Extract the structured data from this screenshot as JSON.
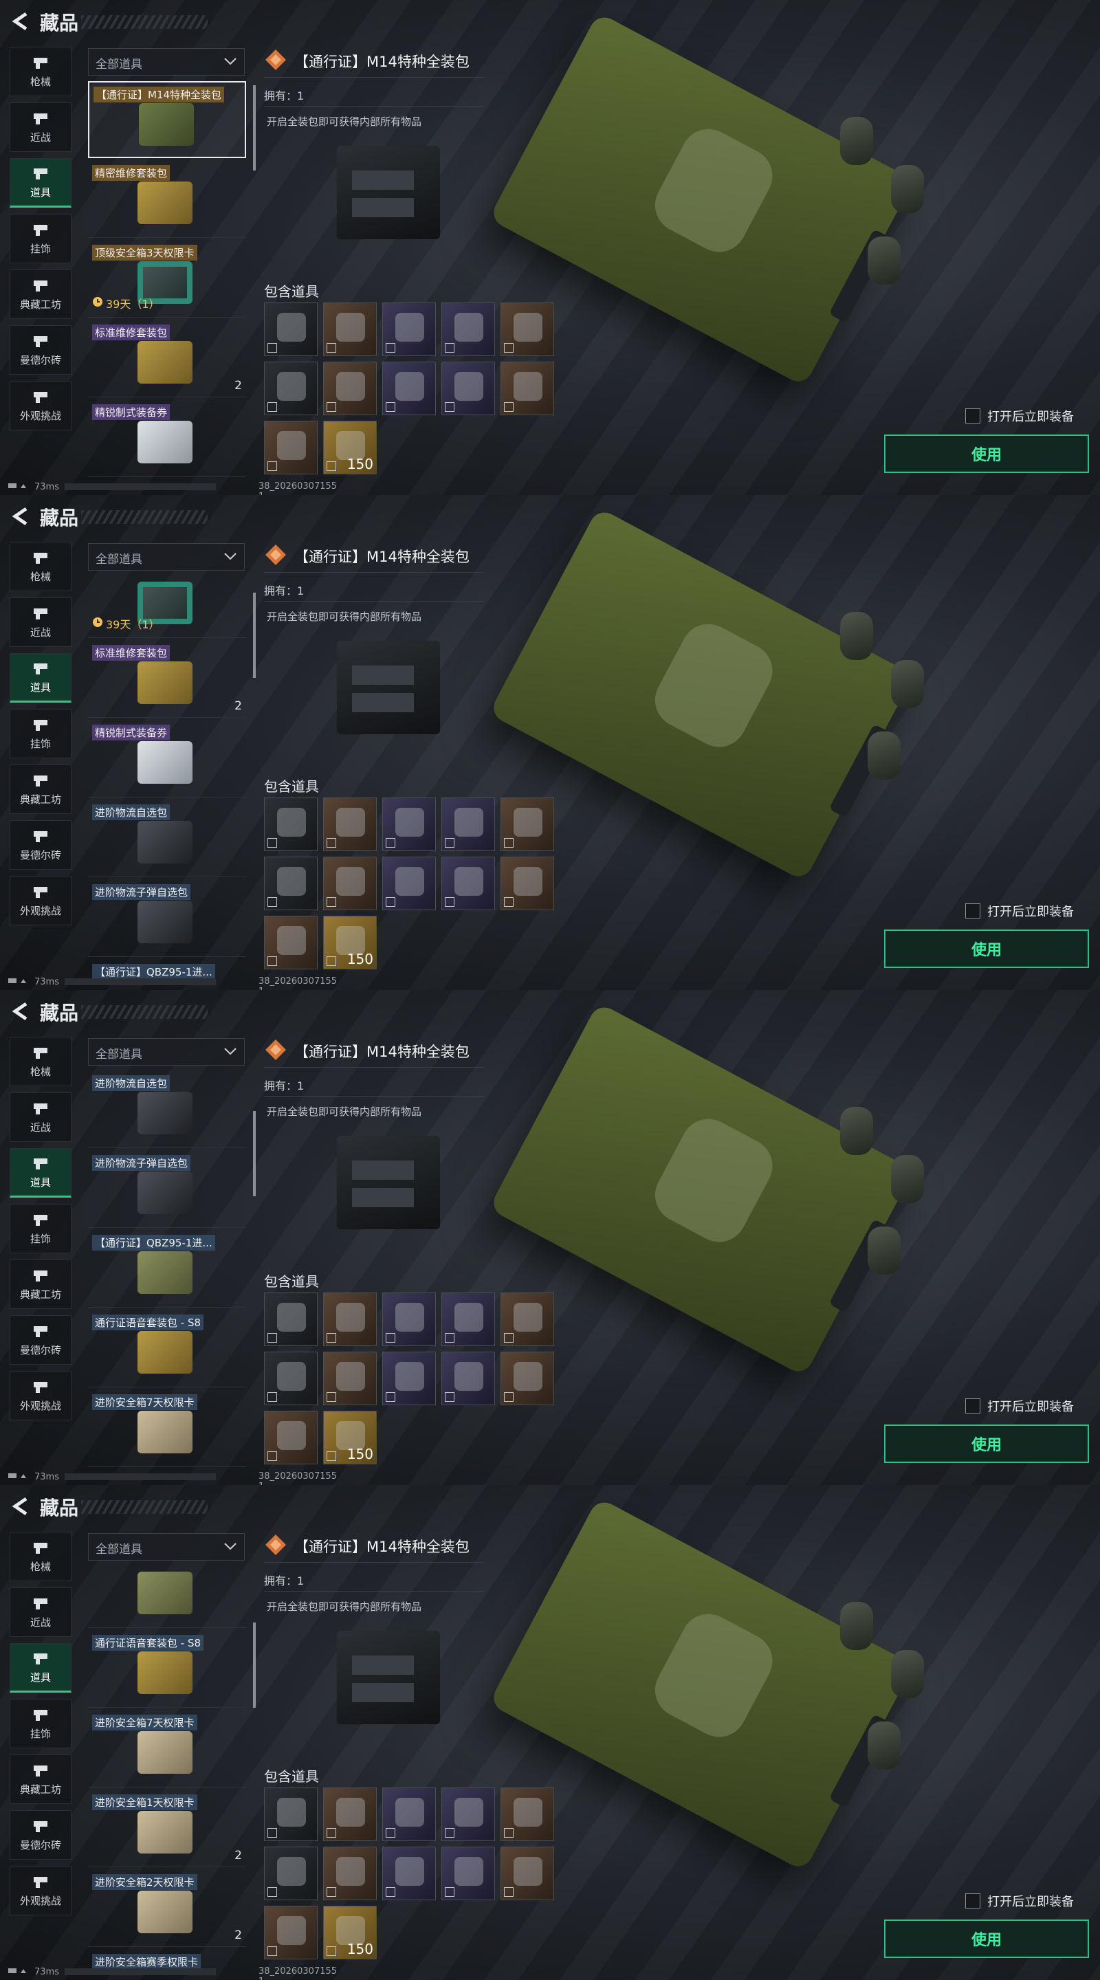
{
  "header": {
    "title": "藏品"
  },
  "sidebar": {
    "items": [
      {
        "label": "枪械",
        "icon": "gun-icon"
      },
      {
        "label": "近战",
        "icon": "knife-icon"
      },
      {
        "label": "道具",
        "icon": "items-icon",
        "active": true
      },
      {
        "label": "挂饰",
        "icon": "charm-icon"
      },
      {
        "label": "典藏工坊",
        "icon": "workshop-icon"
      },
      {
        "label": "曼德尔砖",
        "icon": "brick-icon"
      },
      {
        "label": "外观挑战",
        "icon": "challenge-icon"
      }
    ]
  },
  "filter": {
    "label": "全部道具"
  },
  "detail": {
    "title": "【通行证】M14特种全装包",
    "owned": "拥有：1",
    "description": "开启全装包即可获得内部所有物品",
    "contents_label": "包含道具",
    "contents": [
      {
        "color": "dark"
      },
      {
        "color": "brown"
      },
      {
        "color": "purple"
      },
      {
        "color": "purple"
      },
      {
        "color": "brown"
      },
      {
        "color": "dark"
      },
      {
        "color": "brown"
      },
      {
        "color": "purple"
      },
      {
        "color": "purple"
      },
      {
        "color": "brown"
      },
      {
        "color": "brown"
      },
      {
        "color": "gold",
        "count": "150"
      }
    ],
    "auto_equip_label": "打开后立即装备",
    "use_label": "使用"
  },
  "status": {
    "ping": "73ms",
    "serial": "38_20260307155 1"
  },
  "frames": [
    {
      "items": [
        {
          "name": "【通行证】M14特种全装包",
          "tag": "gold",
          "thumb": "green",
          "selected": true
        },
        {
          "name": "精密维修套装包",
          "tag": "gold",
          "thumb": "gold"
        },
        {
          "name": "顶级安全箱3天权限卡",
          "tag": "gold",
          "thumb": "teal",
          "timer": "39天（1）"
        },
        {
          "name": "标准维修套装包",
          "tag": "purple",
          "thumb": "gold",
          "count": "2"
        },
        {
          "name": "精锐制式装备券",
          "tag": "purple",
          "thumb": "silver"
        }
      ]
    },
    {
      "items": [
        {
          "name": "",
          "tag": "",
          "thumb": "teal",
          "timer": "39天（1）",
          "partial": true
        },
        {
          "name": "标准维修套装包",
          "tag": "purple",
          "thumb": "gold",
          "count": "2"
        },
        {
          "name": "精锐制式装备券",
          "tag": "purple",
          "thumb": "silver"
        },
        {
          "name": "进阶物流自选包",
          "tag": "blue",
          "thumb": "dark"
        },
        {
          "name": "进阶物流子弹自选包",
          "tag": "blue",
          "thumb": "dark"
        },
        {
          "name": "【通行证】QBZ95-1进...",
          "tag": "blue",
          "thumb": "olive"
        }
      ]
    },
    {
      "items": [
        {
          "name": "进阶物流自选包",
          "tag": "blue",
          "thumb": "dark"
        },
        {
          "name": "进阶物流子弹自选包",
          "tag": "blue",
          "thumb": "dark"
        },
        {
          "name": "【通行证】QBZ95-1进...",
          "tag": "blue",
          "thumb": "olive"
        },
        {
          "name": "通行证语音套装包 - S8",
          "tag": "blue",
          "thumb": "gold"
        },
        {
          "name": "进阶安全箱7天权限卡",
          "tag": "blue",
          "thumb": "beige"
        }
      ]
    },
    {
      "items": [
        {
          "name": "",
          "tag": "",
          "thumb": "olive",
          "partial": true
        },
        {
          "name": "通行证语音套装包 - S8",
          "tag": "blue",
          "thumb": "gold"
        },
        {
          "name": "进阶安全箱7天权限卡",
          "tag": "blue",
          "thumb": "beige"
        },
        {
          "name": "进阶安全箱1天权限卡",
          "tag": "blue",
          "thumb": "beige",
          "count": "2"
        },
        {
          "name": "进阶安全箱2天权限卡",
          "tag": "blue",
          "thumb": "beige",
          "count": "2"
        },
        {
          "name": "进阶安全箱赛季权限卡",
          "tag": "blue",
          "thumb": "beige"
        }
      ]
    }
  ]
}
